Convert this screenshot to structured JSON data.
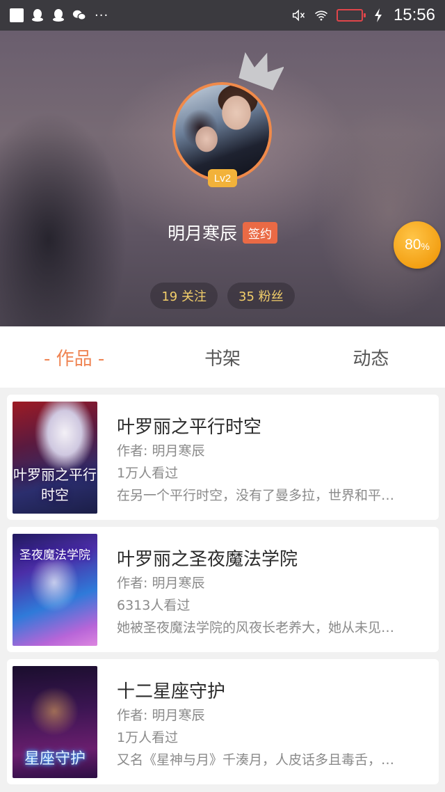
{
  "status_bar": {
    "time": "15:56",
    "more": "···",
    "icons": [
      "notification-square-icon",
      "qq-icon",
      "qq-icon",
      "wechat-icon",
      "mute-icon",
      "wifi-icon",
      "battery-low-icon",
      "charging-icon"
    ]
  },
  "profile": {
    "level": "Lv2",
    "username": "明月寒辰",
    "sign_badge": "签约",
    "progress_value": "80",
    "progress_unit": "%",
    "following": "19 关注",
    "fans": "35 粉丝"
  },
  "tabs": [
    {
      "label": "- 作品 -",
      "active": true
    },
    {
      "label": "书架",
      "active": false
    },
    {
      "label": "动态",
      "active": false
    }
  ],
  "books": [
    {
      "cover_text": "叶罗丽之平行时空",
      "title": "叶罗丽之平行时空",
      "author": "作者: 明月寒辰",
      "views": "1万人看过",
      "summary": "在另一个平行时空，没有了曼多拉，世界和平…"
    },
    {
      "cover_text": "圣夜魔法学院",
      "title": "叶罗丽之圣夜魔法学院",
      "author": "作者: 明月寒辰",
      "views": "6313人看过",
      "summary": "她被圣夜魔法学院的风夜长老养大，她从未见…"
    },
    {
      "cover_text": "星座守护",
      "title": "十二星座守护",
      "author": "作者: 明月寒辰",
      "views": "1万人看过",
      "summary": "又名《星神与月》千湊月，人皮话多且毒舌，…"
    }
  ],
  "colors": {
    "accent": "#ef8453",
    "sign_badge": "#ea6a45",
    "level_badge": "#f2b23a",
    "progress": "#f3a014",
    "stat_text": "#f3cf6a"
  }
}
